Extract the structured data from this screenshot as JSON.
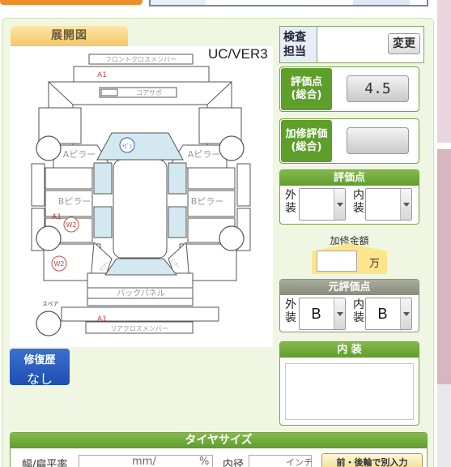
{
  "diagram": {
    "tab_label": "展開図",
    "model_code": "UC/VER3",
    "labels": {
      "front_cross_member": "フロントクロスメンバー",
      "core_support": "コアサポ",
      "a_pillar_left": "Aピラー",
      "a_pillar_right": "Aピラー",
      "b_pillar_left": "Bピラー",
      "b_pillar_right": "Bピラー",
      "back_panel": "バックパネル",
      "rear_cross_member": "リアクロスメンバー",
      "spare": "スペア",
      "roof_mark": "ﾄﾋﾟｪ",
      "inner_left": "ｲﾝﾅｰ",
      "inner_right": "ｲﾝﾅｰ"
    },
    "damage_marks": [
      "A1",
      "A1",
      "W2",
      "W2",
      "A1"
    ]
  },
  "repair_history": {
    "label": "修復歴",
    "value": "なし"
  },
  "inspector": {
    "label": "検査担当",
    "change_button": "変更"
  },
  "overall_score": {
    "label": "評価点(総合)",
    "value": "4.5"
  },
  "repair_score": {
    "label": "加修評価(総合)",
    "value": ""
  },
  "score_section": {
    "title": "評価点",
    "exterior_label": "外装",
    "interior_label": "内装",
    "exterior_value": "",
    "interior_value": ""
  },
  "repair_amount": {
    "label": "加修金額",
    "unit": "万",
    "value": ""
  },
  "original_score": {
    "title": "元評価点",
    "exterior_label": "外装",
    "interior_label": "内装",
    "exterior_value": "B",
    "interior_value": "B"
  },
  "interior_notes": {
    "title": "内 装",
    "value": ""
  },
  "tire": {
    "title": "タイヤサイズ",
    "width_label": "幅/扁平率",
    "mm_unit": "mm/",
    "pct_unit": "%",
    "inner_label": "内径",
    "inch_unit": "インチ",
    "split_button": "前・後輪で別入力"
  }
}
